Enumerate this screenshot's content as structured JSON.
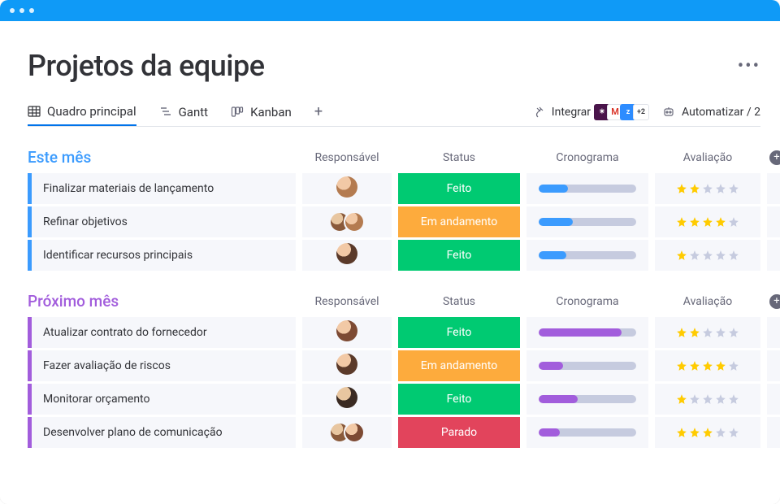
{
  "page": {
    "title": "Projetos da equipe"
  },
  "tabs": {
    "main": {
      "label": "Quadro principal"
    },
    "gantt": {
      "label": "Gantt"
    },
    "kanban": {
      "label": "Kanban"
    }
  },
  "toolbar": {
    "integrate_label": "Integrar",
    "integrate_extra": "+2",
    "automate_label": "Automatizar / 2"
  },
  "columns": {
    "owner": "Responsável",
    "status": "Status",
    "timeline": "Cronograma",
    "rating": "Avaliação"
  },
  "status_labels": {
    "done": "Feito",
    "working": "Em andamento",
    "stuck": "Parado"
  },
  "groups": [
    {
      "id": "g1",
      "title": "Este mês",
      "color": "blue",
      "rows": [
        {
          "task": "Finalizar materiais de lançamento",
          "owners": [
            "a1"
          ],
          "status": "done",
          "timeline_pct": 30,
          "rating": 2
        },
        {
          "task": "Refinar objetivos",
          "owners": [
            "a2",
            "a1"
          ],
          "status": "working",
          "timeline_pct": 35,
          "rating": 4
        },
        {
          "task": "Identificar recursos principais",
          "owners": [
            "a3"
          ],
          "status": "done",
          "timeline_pct": 28,
          "rating": 1
        }
      ]
    },
    {
      "id": "g2",
      "title": "Próximo mês",
      "color": "purple",
      "rows": [
        {
          "task": "Atualizar contrato do fornecedor",
          "owners": [
            "a4"
          ],
          "status": "done",
          "timeline_pct": 85,
          "rating": 2
        },
        {
          "task": "Fazer avaliação de riscos",
          "owners": [
            "a3"
          ],
          "status": "working",
          "timeline_pct": 25,
          "rating": 4
        },
        {
          "task": "Monitorar orçamento",
          "owners": [
            "a5"
          ],
          "status": "done",
          "timeline_pct": 40,
          "rating": 1
        },
        {
          "task": "Desenvolver plano de comunicação",
          "owners": [
            "a2",
            "a4"
          ],
          "status": "stuck",
          "timeline_pct": 22,
          "rating": 3
        }
      ]
    }
  ]
}
